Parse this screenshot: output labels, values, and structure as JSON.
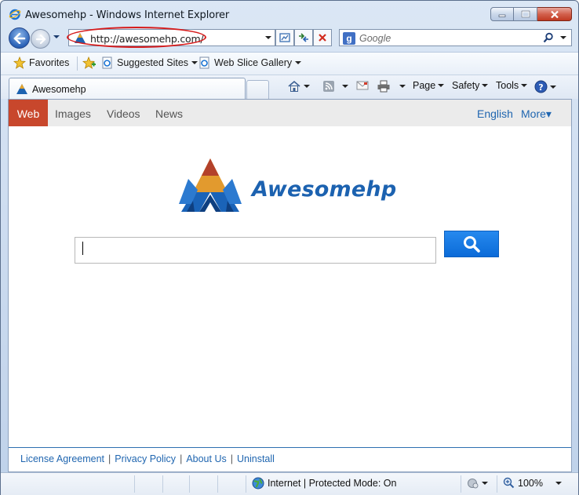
{
  "window": {
    "title": "Awesomehp - Windows Internet Explorer"
  },
  "address_bar": {
    "url": "http://awesomehp.com/"
  },
  "search_bar": {
    "placeholder": "Google"
  },
  "favorites_bar": {
    "favorites_label": "Favorites",
    "suggested_sites_label": "Suggested Sites",
    "web_slice_gallery_label": "Web Slice Gallery"
  },
  "tab": {
    "label": "Awesomehp"
  },
  "command_bar": {
    "page_label": "Page",
    "safety_label": "Safety",
    "tools_label": "Tools"
  },
  "page": {
    "nav": {
      "web": "Web",
      "images": "Images",
      "videos": "Videos",
      "news": "News",
      "language": "English",
      "more": "More▾"
    },
    "logo_text": "Awesomehp",
    "search_value": "",
    "footer": {
      "license": "License Agreement",
      "privacy": "Privacy Policy",
      "about": "About Us",
      "uninstall": "Uninstall",
      "separator": "|"
    }
  },
  "status_bar": {
    "zone_text": "Internet | Protected Mode: On",
    "zoom": "100%"
  },
  "colors": {
    "accent_red": "#c8472c",
    "link_blue": "#2066b0",
    "search_button": "#1a7ae6",
    "logo_blue": "#1c62b0"
  },
  "icons": [
    "ie-logo-icon",
    "back-arrow-icon",
    "forward-arrow-icon",
    "favicon-pyramid-icon",
    "compatibility-icon",
    "refresh-icon",
    "stop-icon",
    "google-icon",
    "magnifier-icon",
    "favorites-star-icon",
    "add-favorites-icon",
    "home-icon",
    "rss-feed-icon",
    "mail-icon",
    "print-icon",
    "help-icon",
    "globe-icon",
    "protected-mode-icon",
    "zoom-icon"
  ]
}
